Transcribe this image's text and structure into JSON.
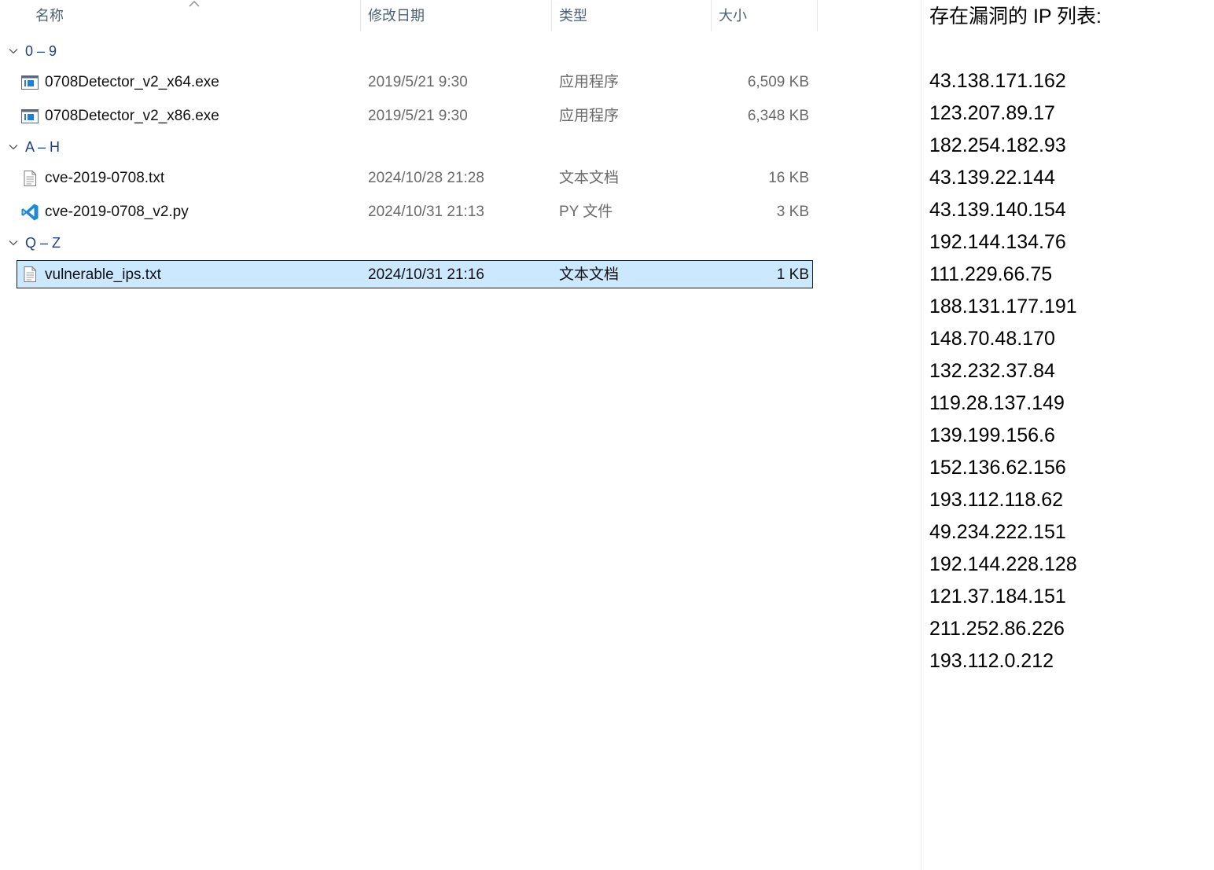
{
  "explorer": {
    "columns": {
      "name": "名称",
      "date": "修改日期",
      "type": "类型",
      "size": "大小"
    },
    "groups": [
      {
        "label": "0 – 9"
      },
      {
        "label": "A – H"
      },
      {
        "label": "Q – Z"
      }
    ],
    "files": [
      {
        "name": "0708Detector_v2_x64.exe",
        "date": "2019/5/21 9:30",
        "type": "应用程序",
        "size": "6,509 KB",
        "icon": "exe-icon"
      },
      {
        "name": "0708Detector_v2_x86.exe",
        "date": "2019/5/21 9:30",
        "type": "应用程序",
        "size": "6,348 KB",
        "icon": "exe-icon"
      },
      {
        "name": "cve-2019-0708.txt",
        "date": "2024/10/28 21:28",
        "type": "文本文档",
        "size": "16 KB",
        "icon": "text-file-icon"
      },
      {
        "name": "cve-2019-0708_v2.py",
        "date": "2024/10/31 21:13",
        "type": "PY 文件",
        "size": "3 KB",
        "icon": "vscode-icon"
      },
      {
        "name": "vulnerable_ips.txt",
        "date": "2024/10/31 21:16",
        "type": "文本文档",
        "size": "1 KB",
        "icon": "text-file-icon",
        "selected": true
      }
    ]
  },
  "output": {
    "title": "存在漏洞的 IP 列表:",
    "ips": [
      "43.138.171.162",
      "123.207.89.17",
      "182.254.182.93",
      "43.139.22.144",
      "43.139.140.154",
      "192.144.134.76",
      "111.229.66.75",
      "188.131.177.191",
      "148.70.48.170",
      "132.232.37.84",
      "119.28.137.149",
      "139.199.156.6",
      "152.136.62.156",
      "193.112.118.62",
      "49.234.222.151",
      "192.144.228.128",
      "121.37.184.151",
      "211.252.86.226",
      "193.112.0.212"
    ]
  },
  "colors": {
    "selection_bg": "#cce8ff",
    "group_label": "#1e3e86",
    "header_text": "#4c607a",
    "vscode_blue": "#1f8ad2"
  }
}
